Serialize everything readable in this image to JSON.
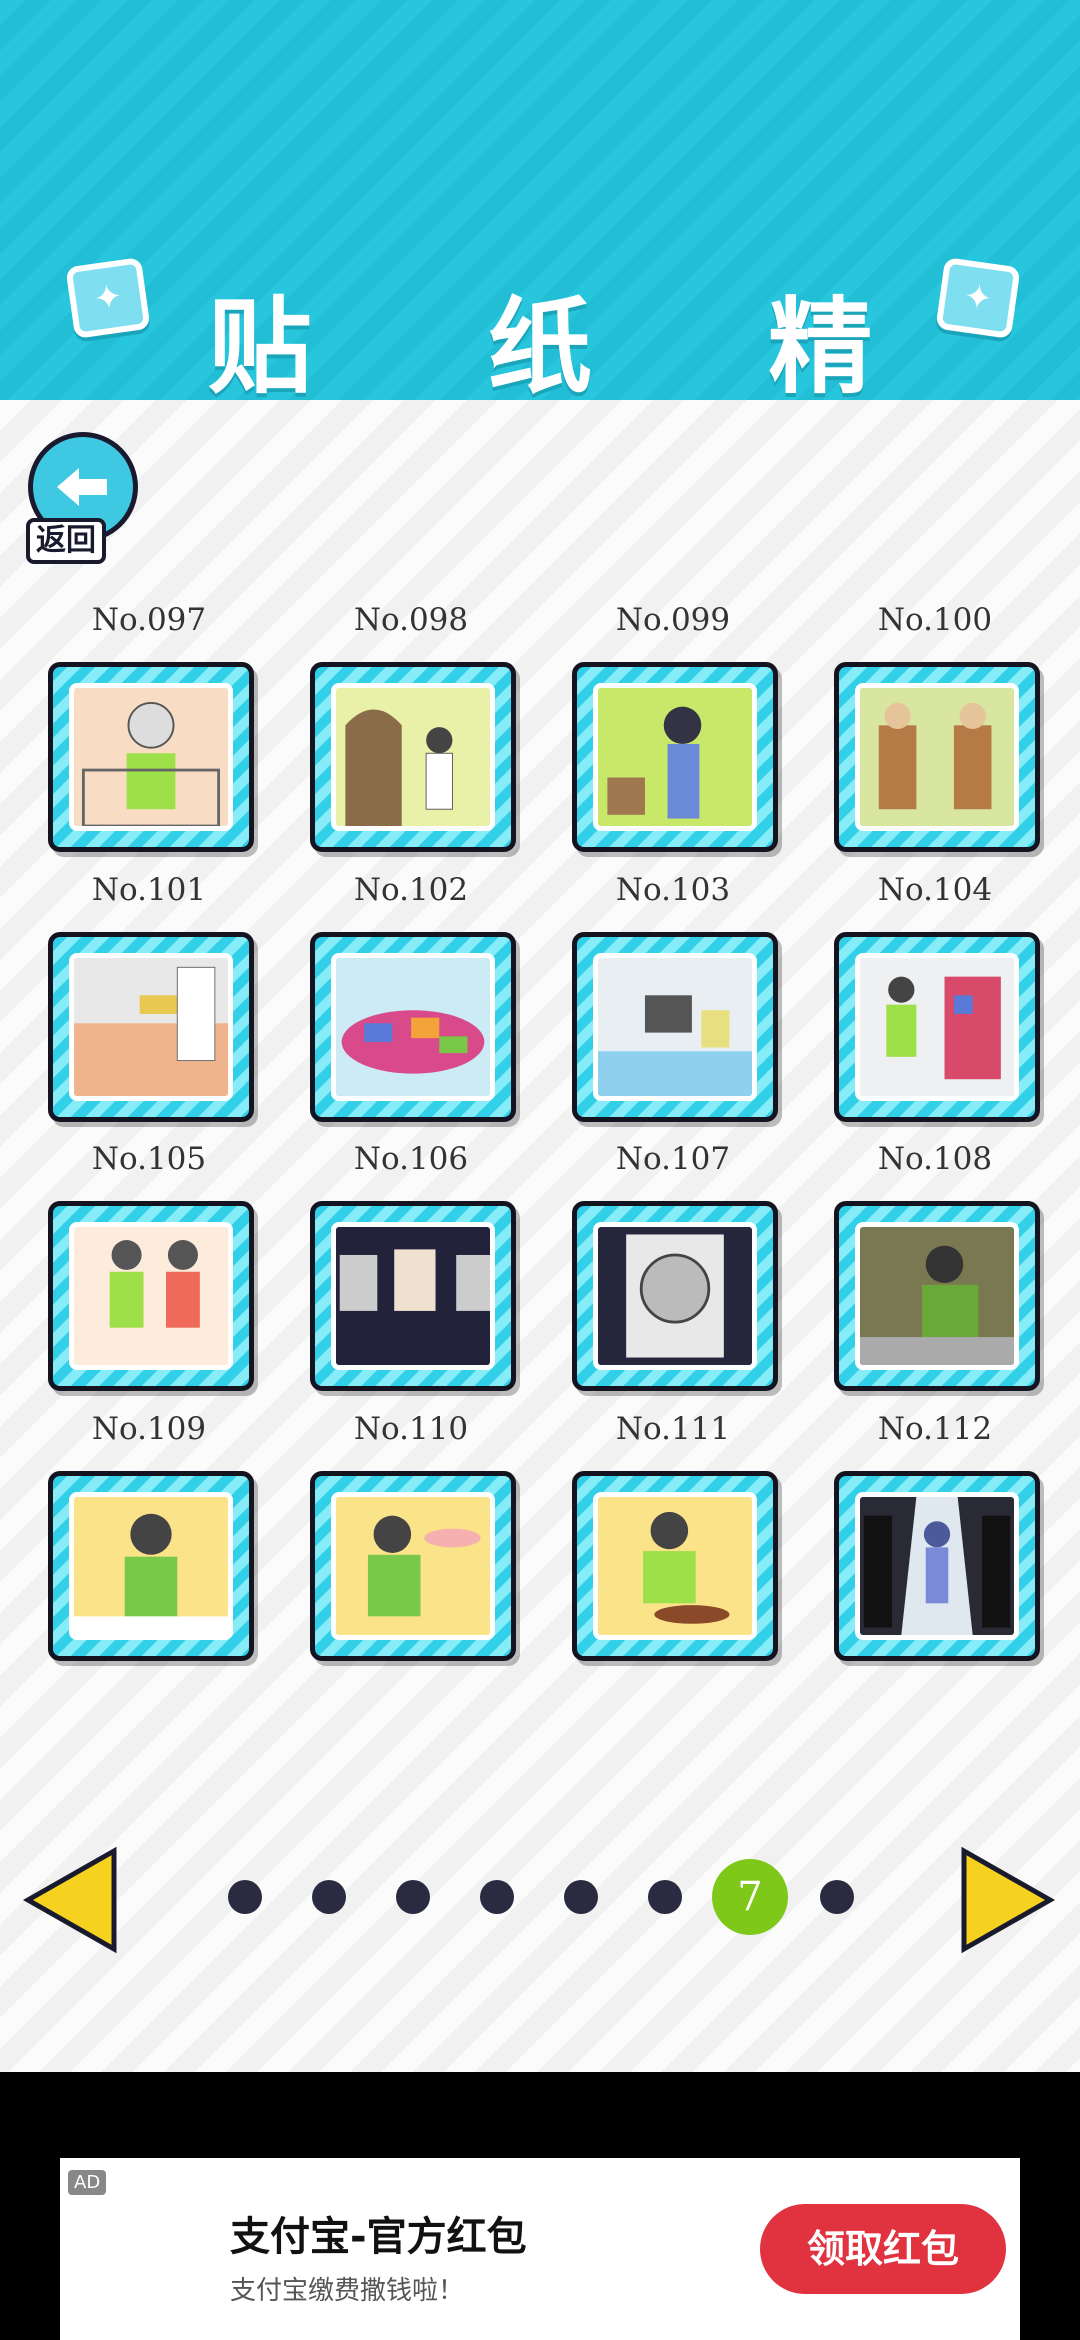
{
  "header": {
    "title": "贴 纸 精 选"
  },
  "back": {
    "label": "返回"
  },
  "stickers": [
    {
      "label": "No.097",
      "scene": "grandma"
    },
    {
      "label": "No.098",
      "scene": "door"
    },
    {
      "label": "No.099",
      "scene": "girl"
    },
    {
      "label": "No.100",
      "scene": "monks"
    },
    {
      "label": "No.101",
      "scene": "locker-empty"
    },
    {
      "label": "No.102",
      "scene": "gifts-pile"
    },
    {
      "label": "No.103",
      "scene": "lockers-fall"
    },
    {
      "label": "No.104",
      "scene": "locker-gifts"
    },
    {
      "label": "No.105",
      "scene": "two-boys"
    },
    {
      "label": "No.106",
      "scene": "portraits"
    },
    {
      "label": "No.107",
      "scene": "poster"
    },
    {
      "label": "No.108",
      "scene": "boy-dark"
    },
    {
      "label": "No.109",
      "scene": "boy-phone"
    },
    {
      "label": "No.110",
      "scene": "boy-drink"
    },
    {
      "label": "No.111",
      "scene": "boy-eat"
    },
    {
      "label": "No.112",
      "scene": "spotlight"
    }
  ],
  "pager": {
    "current": "7",
    "total": 8
  },
  "ad": {
    "tag": "AD",
    "title": "支付宝-官方红包",
    "subtitle": "支付宝缴费撒钱啦！",
    "cta": "领取红包"
  },
  "colors": {
    "header": "#28c6dd",
    "active_dot": "#7ec81a",
    "arrow": "#f4d21f",
    "cta": "#e0323f"
  }
}
